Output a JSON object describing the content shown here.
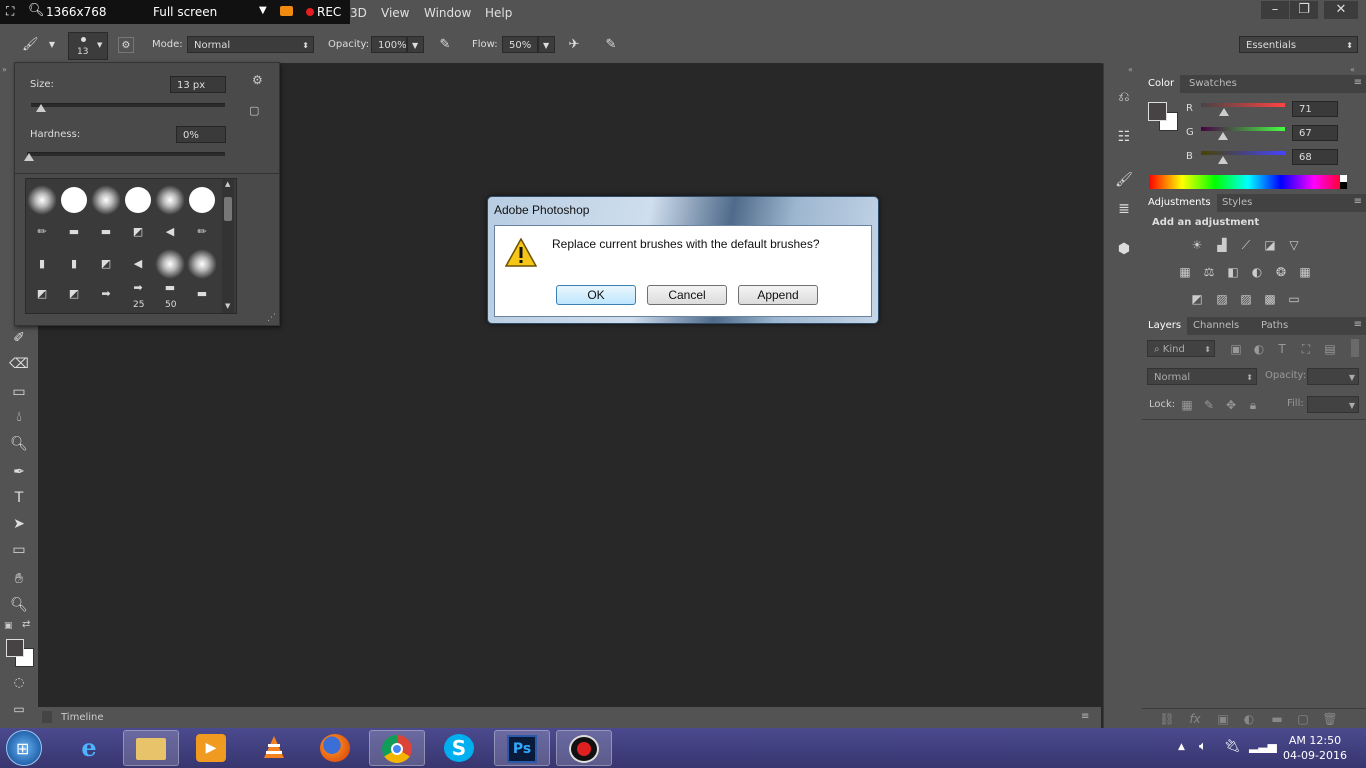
{
  "recorder": {
    "size_label": "1366x768",
    "mode_label": "Full screen",
    "rec_label": "REC"
  },
  "menubar": {
    "items": [
      "3D",
      "View",
      "Window",
      "Help"
    ],
    "window_controls": [
      "–",
      "❐",
      "✕"
    ]
  },
  "options_bar": {
    "brush_size": "13",
    "mode_label": "Mode:",
    "mode_value": "Normal",
    "opacity_label": "Opacity:",
    "opacity_value": "100%",
    "flow_label": "Flow:",
    "flow_value": "50%",
    "workspace": "Essentials"
  },
  "brush_picker": {
    "size_label": "Size:",
    "size_value": "13 px",
    "size_level": 0.05,
    "hardness_label": "Hardness:",
    "hardness_value": "0%",
    "hardness_level": 0.0,
    "tip_labels": [
      "25",
      "50"
    ]
  },
  "dialog": {
    "title": "Adobe Photoshop",
    "message": "Replace current brushes with the default brushes?",
    "buttons": {
      "ok": "OK",
      "cancel": "Cancel",
      "append": "Append"
    }
  },
  "color_panel": {
    "tabs": [
      "Color",
      "Swatches"
    ],
    "channels": [
      {
        "label": "R",
        "value": "71",
        "color": "#e03030"
      },
      {
        "label": "G",
        "value": "67",
        "color": "#30c030"
      },
      {
        "label": "B",
        "value": "68",
        "color": "#3050e0"
      }
    ]
  },
  "adjustments_panel": {
    "tabs": [
      "Adjustments",
      "Styles"
    ],
    "heading": "Add an adjustment"
  },
  "layers_panel": {
    "tabs": [
      "Layers",
      "Channels",
      "Paths"
    ],
    "filter_kind": "Kind",
    "blend_mode": "Normal",
    "opacity_label": "Opacity:",
    "lock_label": "Lock:",
    "fill_label": "Fill:"
  },
  "timeline": {
    "label": "Timeline"
  },
  "taskbar": {
    "apps": [
      "start",
      "internet-explorer",
      "file-explorer",
      "media-player",
      "vlc",
      "firefox",
      "chrome",
      "skype",
      "photoshop",
      "recorder"
    ],
    "ps_label": "Ps",
    "skype_label": "S",
    "clock_time": "AM 12:50",
    "clock_date": "04-09-2016"
  },
  "colors": {
    "accent": "#3c7ecb",
    "rec_red": "#e02020",
    "ps_blue": "#2a5aa8"
  }
}
